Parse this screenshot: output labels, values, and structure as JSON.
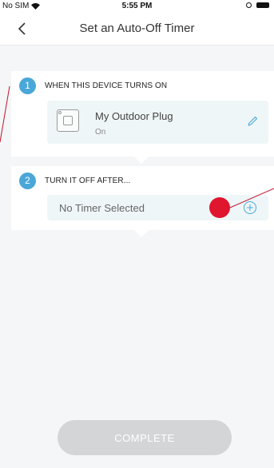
{
  "status_bar": {
    "carrier": "No SIM",
    "time": "5:55 PM"
  },
  "nav": {
    "title": "Set an Auto-Off Timer"
  },
  "step1": {
    "number": "1",
    "title": "WHEN THIS DEVICE TURNS ON",
    "device": {
      "name": "My Outdoor Plug",
      "state": "On"
    }
  },
  "step2": {
    "number": "2",
    "title": "TURN IT OFF AFTER...",
    "timer_label": "No Timer Selected"
  },
  "complete_button": {
    "label": "COMPLETE"
  },
  "colors": {
    "accent": "#4aa7d8",
    "marker": "#e0152e",
    "disabled_button": "#d3d5d6"
  }
}
